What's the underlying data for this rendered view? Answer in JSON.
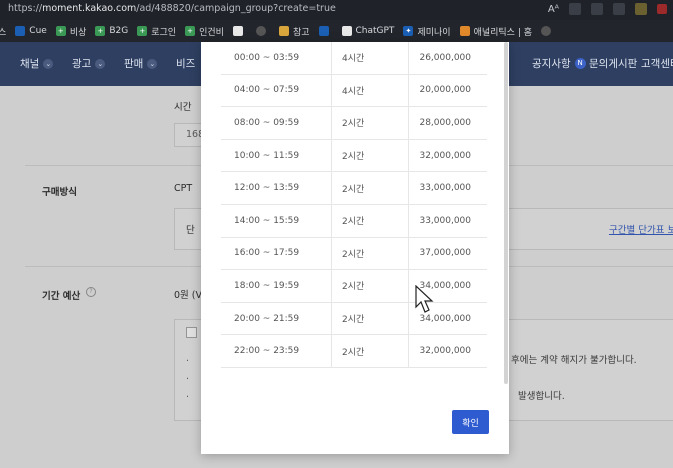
{
  "browser": {
    "url_scheme": "https://",
    "url_host": "moment.kakao.com",
    "url_path": "/ad/488820/campaign_group?create=true",
    "read_mode_icon": "Aᴬ"
  },
  "bookmarks": [
    {
      "label": "스",
      "icon": "green"
    },
    {
      "label": "Cue",
      "icon": "blue"
    },
    {
      "label": "비상",
      "icon": "green"
    },
    {
      "label": "B2G",
      "icon": "green"
    },
    {
      "label": "로그인",
      "icon": "green"
    },
    {
      "label": "인건비",
      "icon": "green"
    },
    {
      "label": "",
      "icon": "white"
    },
    {
      "label": "",
      "icon": "gray"
    },
    {
      "label": "참고",
      "icon": "folder"
    },
    {
      "label": "",
      "icon": "blue"
    },
    {
      "label": "ChatGPT",
      "icon": "white"
    },
    {
      "label": "제미나이",
      "icon": "blue"
    },
    {
      "label": "애널리틱스 | 홈",
      "icon": "orange"
    },
    {
      "label": "",
      "icon": "gray"
    }
  ],
  "nav": {
    "items": [
      "채널",
      "광고",
      "판매",
      "비즈"
    ],
    "right": [
      "공지사항",
      "문의게시판",
      "고객센터"
    ],
    "notice_badge": "N"
  },
  "page": {
    "time_label": "시간",
    "time_value": "168",
    "purchase_label": "구매방식",
    "purchase_value": "CPT",
    "unit_prefix": "단",
    "unit_link": "구간별 단가표 보",
    "budget_label": "기간 예산",
    "budget_value": "0원 (V",
    "notice_1_end": "후에는 계약 해지가 불가합니다.",
    "notice_2_end": "발생합니다."
  },
  "modal": {
    "rows": [
      {
        "time": "00:00 ~ 03:59",
        "duration": "4시간",
        "price": "26,000,000"
      },
      {
        "time": "04:00 ~ 07:59",
        "duration": "4시간",
        "price": "20,000,000"
      },
      {
        "time": "08:00 ~ 09:59",
        "duration": "2시간",
        "price": "28,000,000"
      },
      {
        "time": "10:00 ~ 11:59",
        "duration": "2시간",
        "price": "32,000,000"
      },
      {
        "time": "12:00 ~ 13:59",
        "duration": "2시간",
        "price": "33,000,000"
      },
      {
        "time": "14:00 ~ 15:59",
        "duration": "2시간",
        "price": "33,000,000"
      },
      {
        "time": "16:00 ~ 17:59",
        "duration": "2시간",
        "price": "37,000,000"
      },
      {
        "time": "18:00 ~ 19:59",
        "duration": "2시간",
        "price": "34,000,000"
      },
      {
        "time": "20:00 ~ 21:59",
        "duration": "2시간",
        "price": "34,000,000"
      },
      {
        "time": "22:00 ~ 23:59",
        "duration": "2시간",
        "price": "32,000,000"
      }
    ],
    "confirm_label": "확인"
  }
}
